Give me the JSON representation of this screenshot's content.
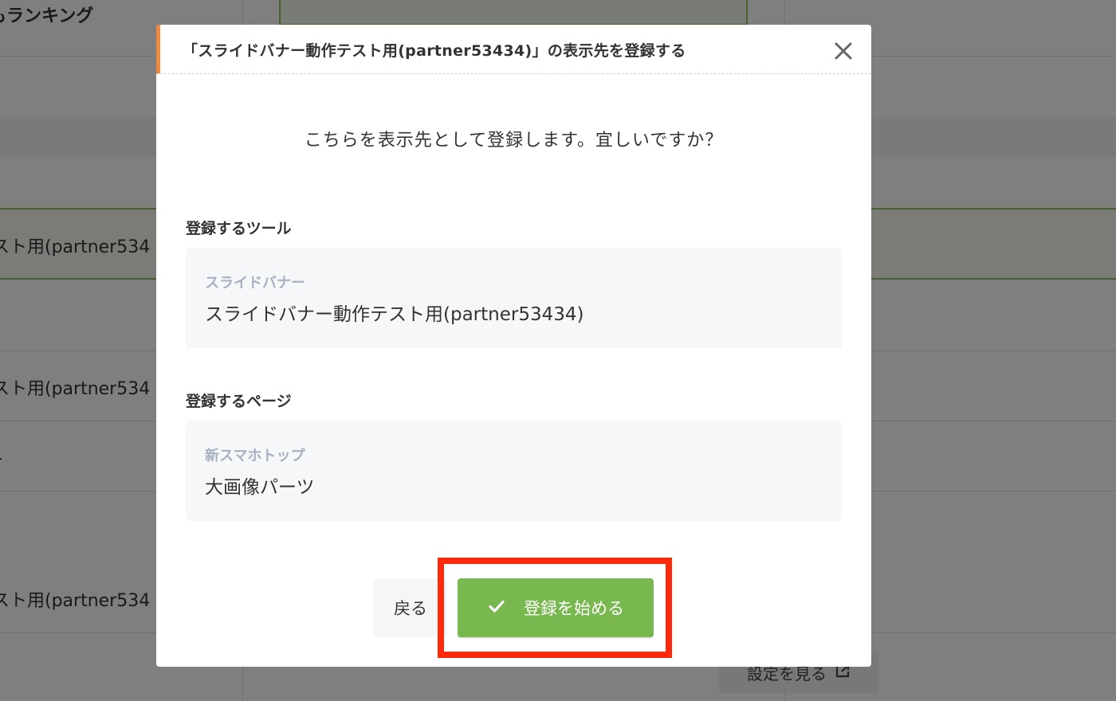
{
  "background": {
    "ranking_heading": "もランキング",
    "row_texts": [
      "スト用(partner534",
      "スト用(partner534",
      "1",
      "スト用(partner534"
    ],
    "settings_button": "設定を見る"
  },
  "modal": {
    "title": "「スライドバナー動作テスト用(partner53434)」の表示先を登録する",
    "question": "こちらを表示先として登録します。宜しいですか？",
    "tool_section": {
      "label": "登録するツール",
      "sub": "スライドバナー",
      "value": "スライドバナー動作テスト用(partner53434)"
    },
    "page_section": {
      "label": "登録するページ",
      "sub": "新スマホトップ",
      "value": "大画像パーツ"
    },
    "back_button": "戻る",
    "start_button": "登録を始める"
  },
  "colors": {
    "accent_orange": "#f08a3c",
    "primary_green": "#78b84f",
    "highlight_red": "#ff2a0c",
    "sub_label": "#a7b1c2"
  },
  "icons": [
    "close-icon",
    "check-icon",
    "external-link-icon"
  ]
}
